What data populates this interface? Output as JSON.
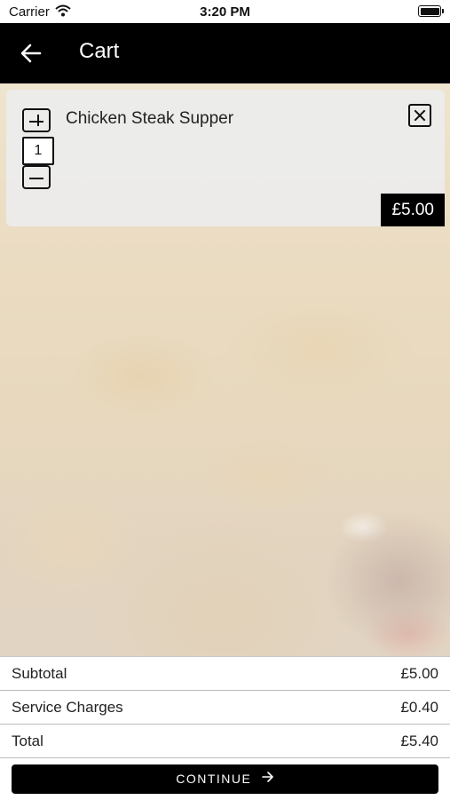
{
  "status_bar": {
    "carrier": "Carrier",
    "time": "3:20 PM"
  },
  "header": {
    "title": "Cart",
    "back_icon": "arrow-left-icon"
  },
  "cart": {
    "items": [
      {
        "name": "Chicken Steak Supper",
        "quantity": "1",
        "price": "£5.00"
      }
    ]
  },
  "summary": {
    "subtotal_label": "Subtotal",
    "subtotal_value": "£5.00",
    "service_label": "Service Charges",
    "service_value": "£0.40",
    "total_label": "Total",
    "total_value": "£5.40"
  },
  "continue_button": {
    "label": "CONTINUE",
    "icon": "arrow-right-icon"
  },
  "colors": {
    "header_bg": "#000000",
    "button_bg": "#000000",
    "card_bg": "#ececec"
  }
}
